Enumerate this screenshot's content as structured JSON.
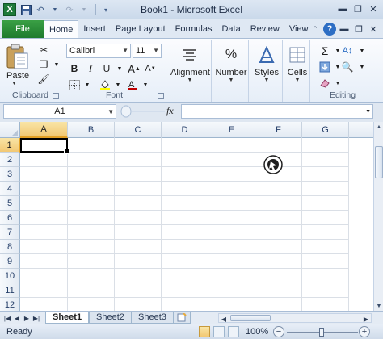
{
  "window": {
    "title": "Book1 - Microsoft Excel"
  },
  "tabs": {
    "file": "File",
    "items": [
      "Home",
      "Insert",
      "Page Layout",
      "Formulas",
      "Data",
      "Review",
      "View"
    ]
  },
  "ribbon": {
    "clipboard": {
      "label": "Clipboard",
      "paste": "Paste"
    },
    "font": {
      "label": "Font",
      "family": "Calibri",
      "size": "11",
      "bold": "B",
      "italic": "I",
      "underline": "U",
      "color_accent": "#c00000",
      "highlight": "#ffff00"
    },
    "alignment": {
      "label": "Alignment"
    },
    "number": {
      "label": "Number",
      "symbol": "%"
    },
    "styles": {
      "label": "Styles"
    },
    "cells": {
      "label": "Cells"
    },
    "editing": {
      "label": "Editing",
      "sum_symbol": "Σ"
    }
  },
  "formula_bar": {
    "name_box": "A1",
    "fx": "fx",
    "value": ""
  },
  "grid": {
    "columns": [
      "A",
      "B",
      "C",
      "D",
      "E",
      "F",
      "G"
    ],
    "rows": [
      "1",
      "2",
      "3",
      "4",
      "5",
      "6",
      "7",
      "8",
      "9",
      "10",
      "11",
      "12"
    ],
    "selected_col": "A",
    "selected_row": "1"
  },
  "sheets": [
    "Sheet1",
    "Sheet2",
    "Sheet3"
  ],
  "status": {
    "text": "Ready",
    "zoom": "100%"
  },
  "colors": {
    "file_tab": "#2a8c37",
    "selection_header": "#f2c873",
    "help": "#2d6ec4"
  }
}
